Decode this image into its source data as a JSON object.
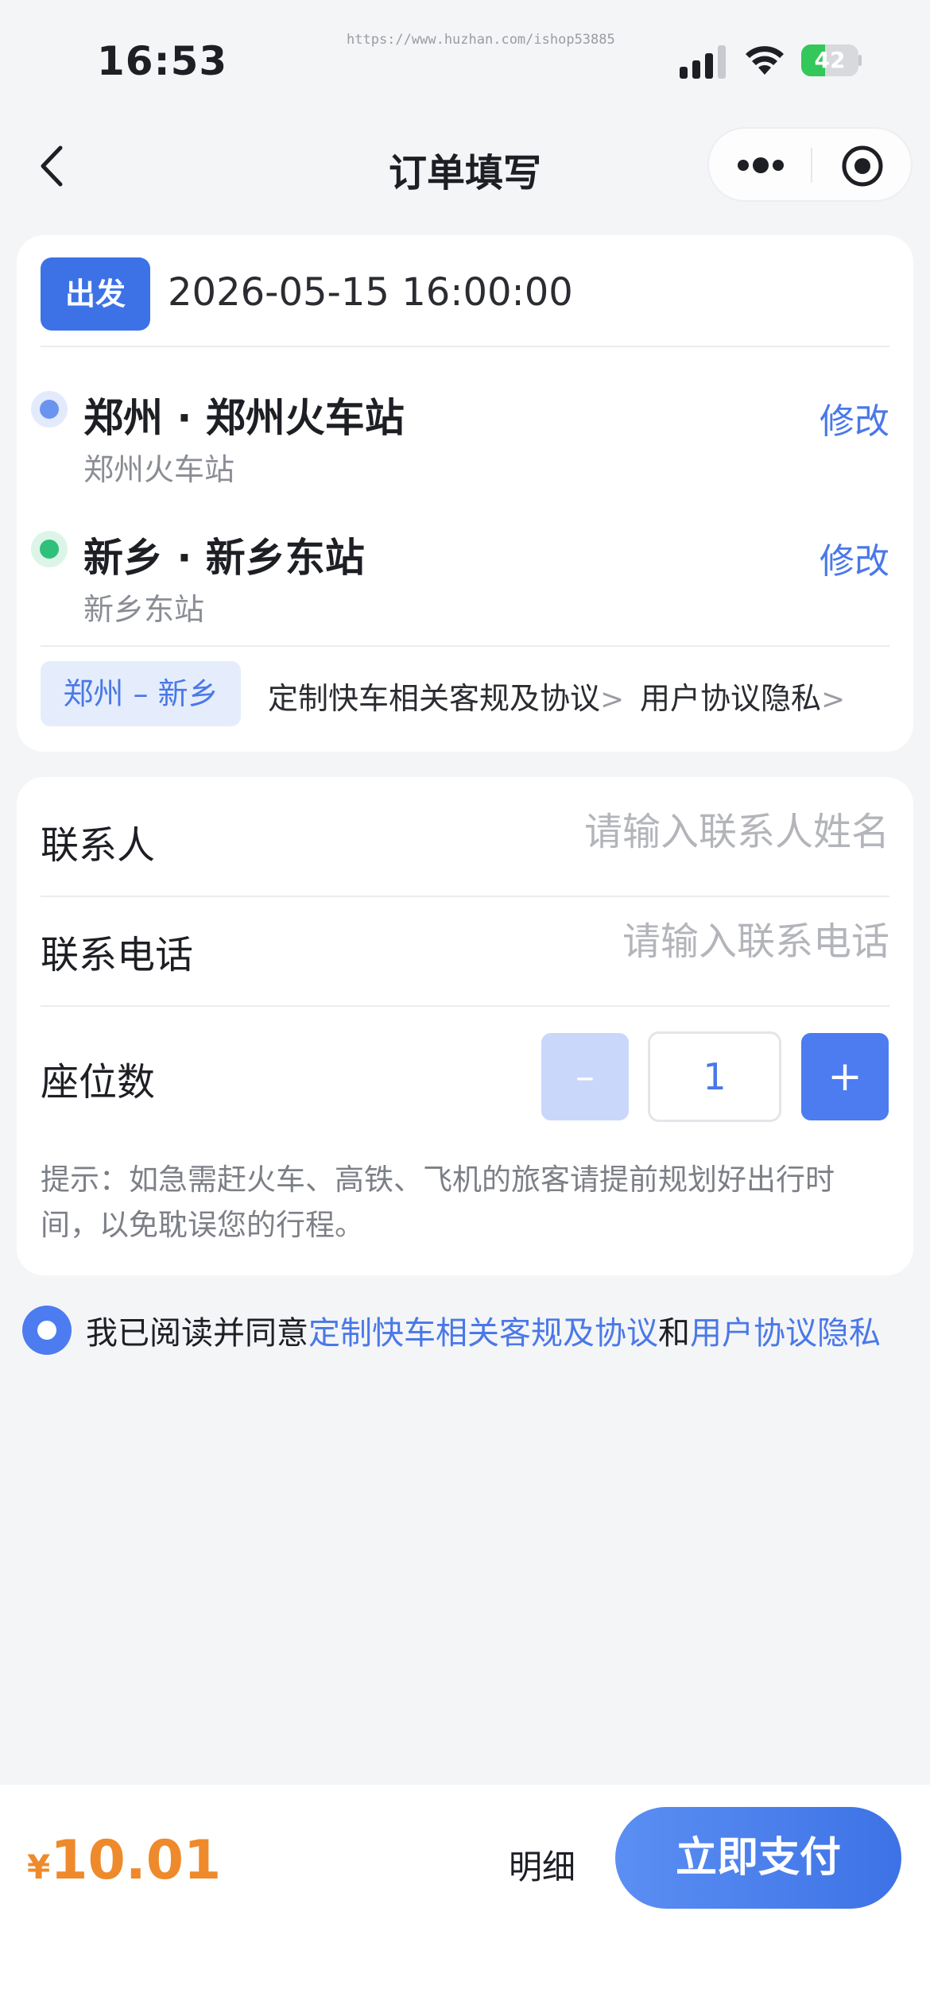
{
  "status_bar": {
    "time": "16:53",
    "watermark": "https://www.huzhan.com/ishop53885",
    "battery_level": 42,
    "battery_text": "42"
  },
  "nav": {
    "title": "订单填写"
  },
  "trip": {
    "depart_label": "出发",
    "depart_time": "2026-05-15 16:00:00",
    "origin": {
      "name": "郑州 · 郑州火车站",
      "sub": "郑州火车站",
      "modify_label": "修改"
    },
    "destination": {
      "name": "新乡 · 新乡东站",
      "sub": "新乡东站",
      "modify_label": "修改"
    },
    "route_tag": "郑州 – 新乡",
    "rules_link": "定制快车相关客规及协议",
    "privacy_link": "用户协议隐私",
    "link_chevron": ">"
  },
  "form": {
    "contact_label": "联系人",
    "contact_placeholder": "请输入联系人姓名",
    "contact_value": "",
    "phone_label": "联系电话",
    "phone_placeholder": "请输入联系电话",
    "phone_value": "",
    "seat_label": "座位数",
    "seat_count": "1",
    "minus_label": "–",
    "plus_label": "+",
    "tip": "提示：如急需赶火车、高铁、飞机的旅客请提前规划好出行时间，以免耽误您的行程。"
  },
  "agreement": {
    "checked": true,
    "prefix": "我已阅读并同意",
    "rules_link": "定制快车相关客规及协议",
    "conjunction": "和",
    "privacy_link": "用户协议隐私"
  },
  "bottom": {
    "currency": "¥",
    "price": "10.01",
    "detail_label": "明细",
    "pay_label": "立即支付"
  },
  "colors": {
    "accent": "#4c7cf0",
    "link": "#4a78e8",
    "price": "#ee8a2b",
    "background": "#f4f5f7",
    "origin_dot": "#6b94f0",
    "destination_dot": "#2fc07a",
    "battery": "#34c759"
  },
  "icons": {
    "back": "chevron-left-icon",
    "more": "more-dots-icon",
    "close_app": "target-circle-icon",
    "signal": "cellular-signal-icon",
    "wifi": "wifi-icon",
    "battery": "battery-icon"
  }
}
